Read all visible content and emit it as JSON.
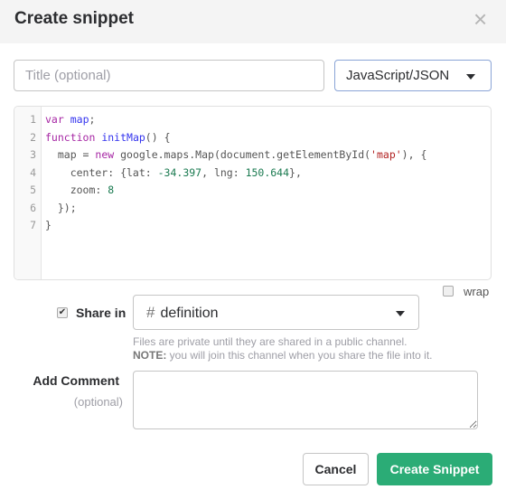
{
  "dialog": {
    "title": "Create snippet",
    "close_icon": "×"
  },
  "title_input": {
    "value": "",
    "placeholder": "Title (optional)"
  },
  "language": {
    "selected": "JavaScript/JSON"
  },
  "editor": {
    "line_numbers": [
      "1",
      "2",
      "3",
      "4",
      "5",
      "6",
      "7"
    ],
    "lines": [
      [
        [
          "kw",
          "var"
        ],
        [
          "pl",
          " "
        ],
        [
          "def",
          "map"
        ],
        [
          "pl",
          ";"
        ]
      ],
      [
        [
          "kw",
          "function"
        ],
        [
          "pl",
          " "
        ],
        [
          "def",
          "initMap"
        ],
        [
          "pl",
          "() {"
        ]
      ],
      [
        [
          "pl",
          "  map = "
        ],
        [
          "kw",
          "new"
        ],
        [
          "pl",
          " google.maps.Map(document.getElementById("
        ],
        [
          "str",
          "'map'"
        ],
        [
          "pl",
          "), {"
        ]
      ],
      [
        [
          "pl",
          "    center: {lat: "
        ],
        [
          "num",
          "-34.397"
        ],
        [
          "pl",
          ", lng: "
        ],
        [
          "num",
          "150.644"
        ],
        [
          "pl",
          "},"
        ]
      ],
      [
        [
          "pl",
          "    zoom: "
        ],
        [
          "num",
          "8"
        ]
      ],
      [
        [
          "pl",
          "  });"
        ]
      ],
      [
        [
          "pl",
          "}"
        ]
      ]
    ]
  },
  "wrap": {
    "label": "wrap",
    "checked": false
  },
  "share": {
    "label": "Share in",
    "checked": true,
    "check_mark": "✔",
    "channel_hash": "#",
    "channel": "definition",
    "help_1": "Files are private until they are shared in a public channel.",
    "help_note_label": "NOTE:",
    "help_note": " you will join this channel when you share the file into it."
  },
  "comment": {
    "label": "Add Comment",
    "optional": "(optional)",
    "value": ""
  },
  "buttons": {
    "cancel": "Cancel",
    "create": "Create Snippet"
  },
  "colors": {
    "primary": "#2bac76",
    "header_bg": "#f4f4f4"
  }
}
